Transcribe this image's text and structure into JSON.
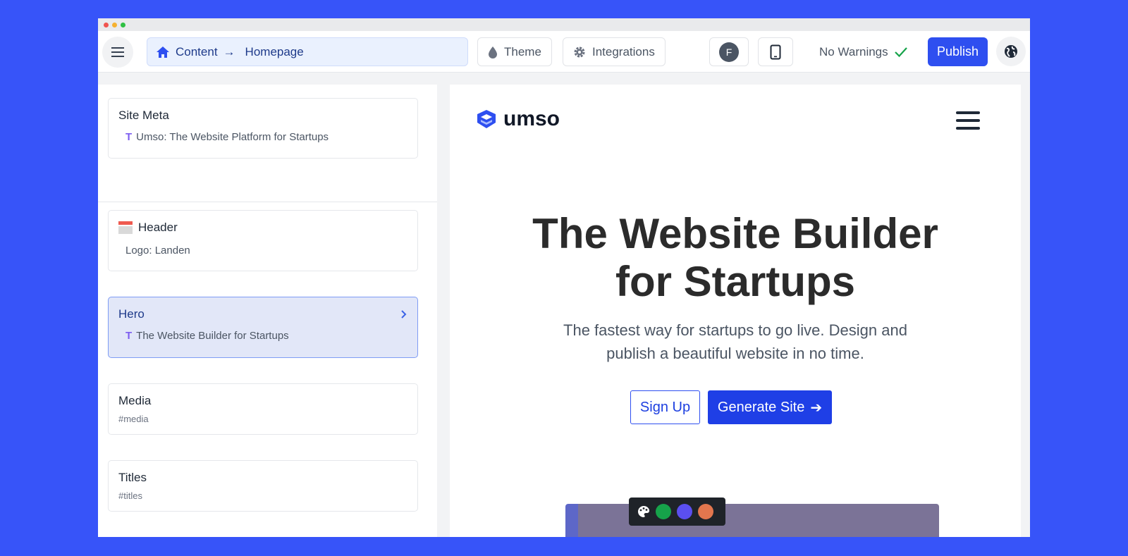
{
  "toolbar": {
    "breadcrumb_root": "Content",
    "breadcrumb_page": "Homepage",
    "theme_label": "Theme",
    "integrations_label": "Integrations",
    "avatar_initial": "F",
    "warnings_label": "No Warnings",
    "publish_label": "Publish"
  },
  "sidebar": {
    "site_meta": {
      "title": "Site Meta",
      "value": "Umso: The Website Platform for Startups"
    },
    "sections": [
      {
        "title": "Header",
        "value": "Logo: Landen"
      },
      {
        "title": "Hero",
        "value": "The Website Builder for Startups"
      },
      {
        "title": "Media",
        "tag": "#media"
      },
      {
        "title": "Titles",
        "tag": "#titles"
      }
    ]
  },
  "preview": {
    "logo_text": "umso",
    "hero_title_line1": "The Website Builder",
    "hero_title_line2": "for Startups",
    "hero_subtitle_line1": "The fastest way for startups to go live. Design and",
    "hero_subtitle_line2": "publish a beautiful website in no time.",
    "signup_label": "Sign Up",
    "generate_label": "Generate Site"
  },
  "colors": {
    "background": "#3754f9",
    "accent": "#2e4ff0",
    "swatch_green": "#16a34a",
    "swatch_purple": "#5b4ff0",
    "swatch_orange": "#e2764e"
  }
}
